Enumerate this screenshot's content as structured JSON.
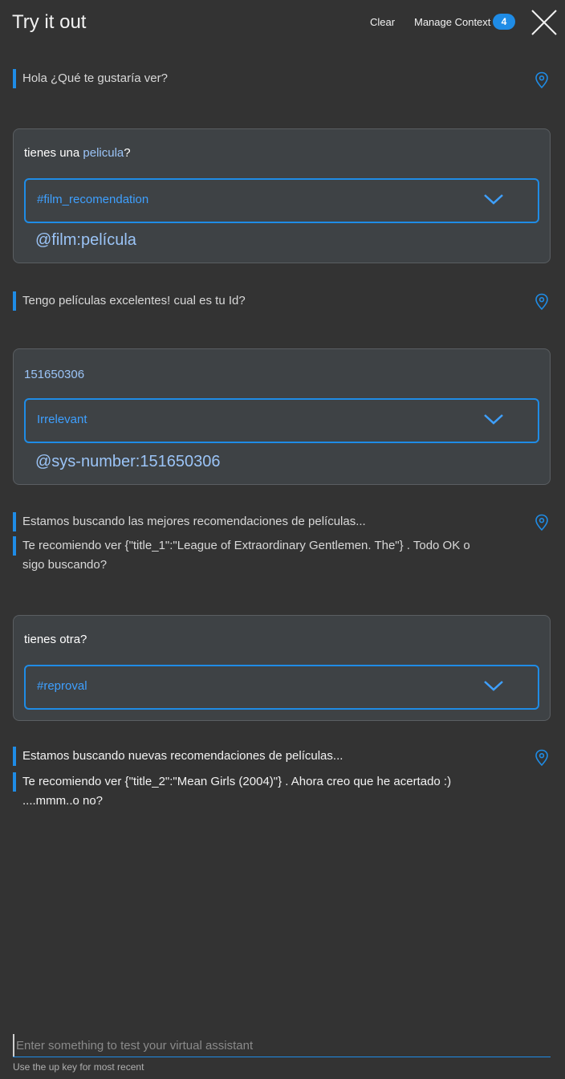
{
  "header": {
    "title": "Try it out",
    "clear_label": "Clear",
    "manage_context_label": "Manage Context",
    "context_count": "4"
  },
  "messages": {
    "bot1": "Hola ¿Qué te gustaría ver?",
    "user1": {
      "text_before": "tienes una ",
      "text_highlight": "pelicula",
      "text_after": "?",
      "intent": "#film_recomendation",
      "entity": "@film:película"
    },
    "bot2": "Tengo películas excelentes! cual es tu Id?",
    "user2": {
      "text": "151650306",
      "intent": "Irrelevant",
      "entity": "@sys-number:151650306"
    },
    "bot3a": "Estamos buscando las mejores recomendaciones de películas...",
    "bot3b": "Te recomiendo ver {\"title_1\":\"League of Extraordinary Gentlemen. The\"} . Todo OK o sigo buscando?",
    "user3": {
      "text": "tienes otra?",
      "intent": "#reproval"
    },
    "bot4a": "Estamos buscando nuevas recomendaciones de películas...",
    "bot4b": "Te recomiendo ver {\"title_2\":\"Mean Girls (2004)\"} . Ahora creo que he acertado :) ....mmm..o no?"
  },
  "input": {
    "placeholder": "Enter something to test your virtual assistant",
    "hint": "Use the up key for most recent"
  },
  "colors": {
    "background": "#333333",
    "accent": "#1f8ce6",
    "card": "#3e4245",
    "entity": "#9bc4f7"
  }
}
